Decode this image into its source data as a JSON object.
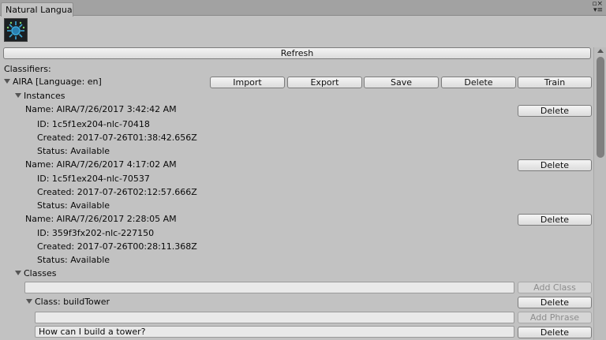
{
  "window": {
    "tab_title": "Natural Langua",
    "controls": [
      "menu-icon",
      "close-icon"
    ]
  },
  "toolbar": {
    "logo_icon": "watson-logo-icon",
    "refresh_label": "Refresh"
  },
  "classifiers": {
    "section_label": "Classifiers:",
    "name": "AIRA [Language: en]",
    "actions": {
      "import": "Import",
      "export": "Export",
      "save": "Save",
      "delete": "Delete",
      "train": "Train"
    }
  },
  "instances": {
    "label": "Instances",
    "delete_label": "Delete",
    "items": [
      {
        "name": "Name: AIRA/7/26/2017 3:42:42 AM",
        "id": "ID: 1c5f1ex204-nlc-70418",
        "created": "Created: 2017-07-26T01:38:42.656Z",
        "status": "Status: Available"
      },
      {
        "name": "Name: AIRA/7/26/2017 4:17:02 AM",
        "id": "ID: 1c5f1ex204-nlc-70537",
        "created": "Created: 2017-07-26T02:12:57.666Z",
        "status": "Status: Available"
      },
      {
        "name": "Name: AIRA/7/26/2017 2:28:05 AM",
        "id": "ID: 359f3fx202-nlc-227150",
        "created": "Created: 2017-07-26T00:28:11.368Z",
        "status": "Status: Available"
      }
    ]
  },
  "classes": {
    "label": "Classes",
    "new_class_value": "",
    "add_class_label": "Add Class",
    "class_item": {
      "label": "Class: buildTower",
      "delete_label": "Delete",
      "new_phrase_value": "",
      "add_phrase_label": "Add Phrase",
      "phrases": [
        {
          "value": "How can I build a tower?",
          "delete_label": "Delete"
        }
      ]
    }
  }
}
